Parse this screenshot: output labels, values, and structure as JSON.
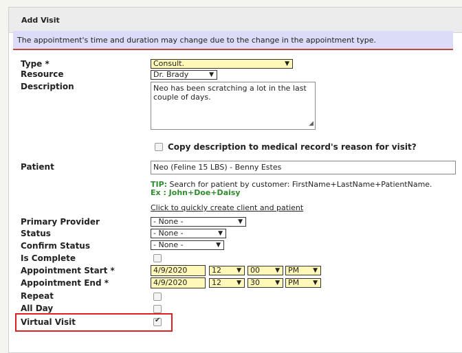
{
  "panel": {
    "title": "Add Visit"
  },
  "notice": "The appointment's time and duration may change due to the change in the appointment type.",
  "labels": {
    "type": "Type *",
    "resource": "Resource",
    "description": "Description",
    "patient": "Patient",
    "primary_provider": "Primary Provider",
    "status": "Status",
    "confirm_status": "Confirm Status",
    "is_complete": "Is Complete",
    "appointment_start": "Appointment Start *",
    "appointment_end": "Appointment End *",
    "repeat": "Repeat",
    "all_day": "All Day",
    "virtual_visit": "Virtual Visit"
  },
  "fields": {
    "type": "Consult.",
    "resource": "Dr. Brady",
    "description": "Neo has been scratching a lot in the last couple of days.",
    "copy_description": "Copy description to medical record's reason for visit?",
    "patient": "Neo (Feline 15 LBS) - Benny Estes",
    "tip_label": "TIP:",
    "tip_text": " Search for patient by customer: FirstName+LastName+PatientName.",
    "tip_example": "Ex  : John+Doe+Daisy",
    "create_link": "Click to quickly create client and patient",
    "primary_provider": "- None -",
    "status": "- None -",
    "confirm_status": "- None -",
    "start_date": "4/9/2020",
    "start_hour": "12",
    "start_min": "00",
    "start_ampm": "PM",
    "end_date": "4/9/2020",
    "end_hour": "12",
    "end_min": "30",
    "end_ampm": "PM"
  },
  "checkboxes": {
    "copy_description": false,
    "is_complete": false,
    "repeat": false,
    "all_day": false,
    "virtual_visit": true
  },
  "icons": {
    "dropdown": "▼",
    "resize": "◢"
  },
  "colors": {
    "notice_bg": "#dcdcf8",
    "notice_border": "#b94a4a",
    "field_highlight": "#fff8b8",
    "tip_green": "#2e8b2e",
    "highlight_box": "#e02020"
  }
}
